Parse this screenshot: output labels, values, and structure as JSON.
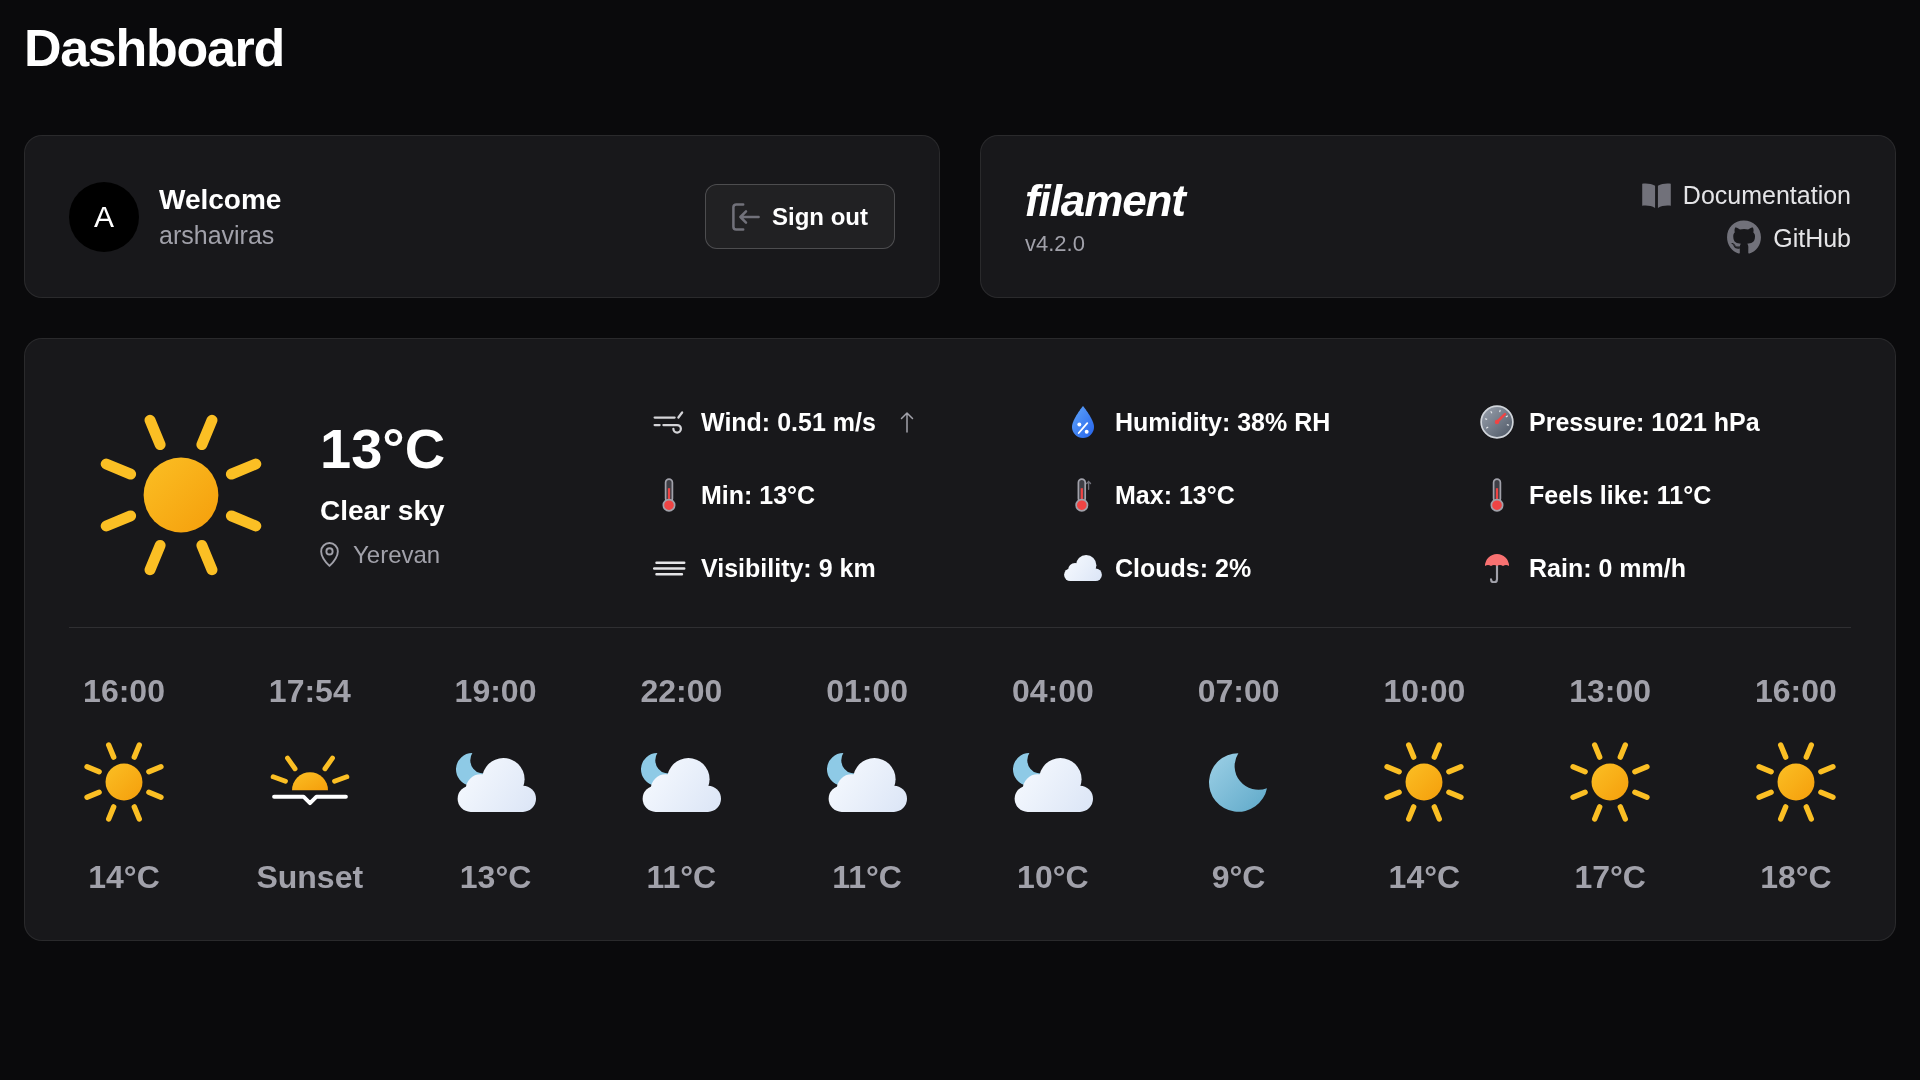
{
  "page_title": "Dashboard",
  "account_card": {
    "avatar_initial": "A",
    "greeting": "Welcome",
    "username": "arshaviras",
    "sign_out_button": "Sign out"
  },
  "info_card": {
    "logo": "filament",
    "version": "v4.2.0",
    "links": [
      {
        "kind": "docs",
        "label": "Documentation"
      },
      {
        "kind": "github",
        "label": "GitHub"
      }
    ]
  },
  "weather_card": {
    "temperature": "13°C",
    "condition": "Clear sky",
    "location": "Yerevan",
    "stats": [
      {
        "kind": "wind",
        "text": "Wind: 0.51 m/s"
      },
      {
        "kind": "humidity",
        "text": "Humidity: 38% RH"
      },
      {
        "kind": "pressure",
        "text": "Pressure: 1021 hPa"
      },
      {
        "kind": "min",
        "text": "Min: 13°C"
      },
      {
        "kind": "max",
        "text": "Max: 13°C"
      },
      {
        "kind": "feels",
        "text": "Feels like: 11°C"
      },
      {
        "kind": "visibility",
        "text": "Visibility: 9 km"
      },
      {
        "kind": "clouds",
        "text": "Clouds: 2%"
      },
      {
        "kind": "rain",
        "text": "Rain: 0 mm/h"
      }
    ],
    "forecast": [
      {
        "time": "16:00",
        "kind": "sun",
        "value": "14°C"
      },
      {
        "time": "17:54",
        "kind": "sunset",
        "value": "Sunset"
      },
      {
        "time": "19:00",
        "kind": "cloudy",
        "value": "13°C"
      },
      {
        "time": "22:00",
        "kind": "cloudy",
        "value": "11°C"
      },
      {
        "time": "01:00",
        "kind": "cloudy",
        "value": "11°C"
      },
      {
        "time": "04:00",
        "kind": "cloudy",
        "value": "10°C"
      },
      {
        "time": "07:00",
        "kind": "moon",
        "value": "9°C"
      },
      {
        "time": "10:00",
        "kind": "sun",
        "value": "14°C"
      },
      {
        "time": "13:00",
        "kind": "sun",
        "value": "17°C"
      },
      {
        "time": "16:00",
        "kind": "sun",
        "value": "18°C"
      }
    ]
  }
}
